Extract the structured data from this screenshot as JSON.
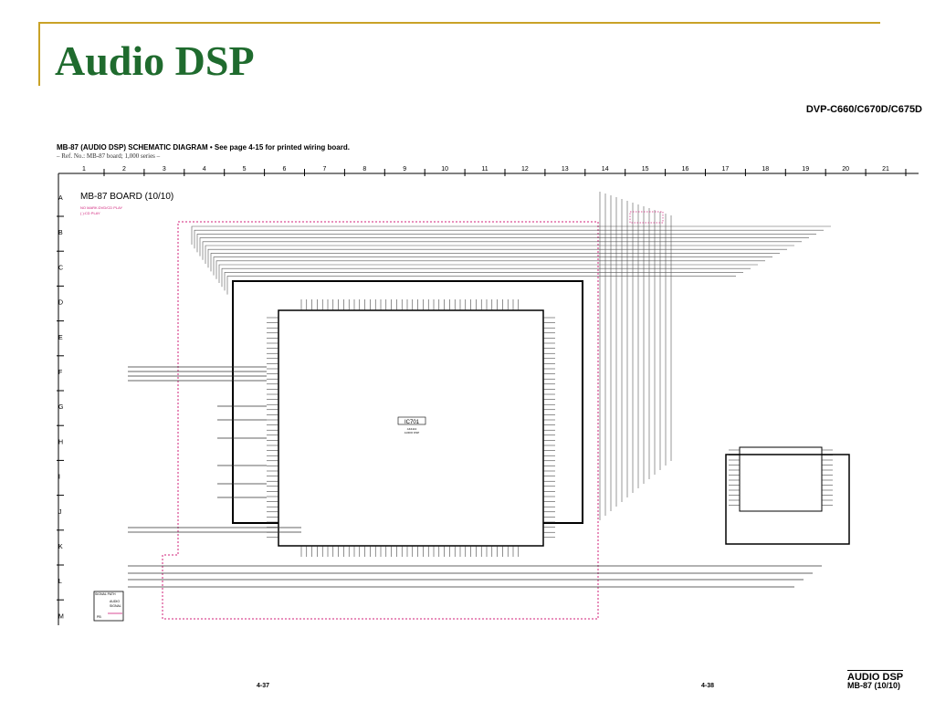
{
  "slide": {
    "title": "Audio DSP",
    "model": "DVP-C660/C670D/C675D",
    "diagram_title": "MB-87 (AUDIO DSP) SCHEMATIC DIAGRAM",
    "diagram_note": "• See page 4-15 for printed wiring board.",
    "ref_line": "– Ref. No.: MB-87 board; 1,000 series –",
    "page_left": "4-37",
    "page_right": "4-38",
    "footer_title": "AUDIO DSP",
    "footer_subtitle": "MB-87 (10/10)"
  },
  "schematic": {
    "board_label": "MB-87 BOARD (10/10)",
    "board_note_1": "NO MARK:DVD/CD PLAY",
    "board_note_2": "( ):CD PLAY",
    "ic_label": "IC701",
    "ic_sub_1": "AK4113",
    "ic_sub_2": "AUDIO DSP",
    "signal_path_label": "SIGNAL PATH",
    "signal_path_audio": "AUDIO",
    "signal_path_signal": "SIGNAL",
    "signal_path_pb": "PB",
    "columns": [
      "1",
      "2",
      "3",
      "4",
      "5",
      "6",
      "7",
      "8",
      "9",
      "10",
      "11",
      "12",
      "13",
      "14",
      "15",
      "16",
      "17",
      "18",
      "19",
      "20",
      "21"
    ],
    "rows": [
      "A",
      "B",
      "C",
      "D",
      "E",
      "F",
      "G",
      "H",
      "I",
      "J",
      "K",
      "L",
      "M"
    ],
    "colors": {
      "wire": "#444444",
      "dashed_region": "#d0207a",
      "heavy": "#000000"
    }
  }
}
